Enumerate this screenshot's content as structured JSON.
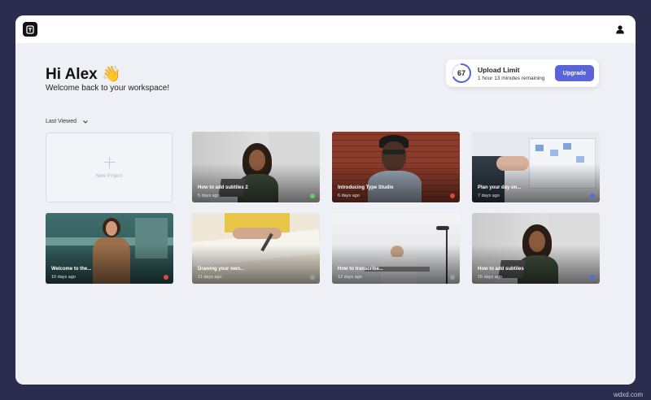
{
  "app": {
    "logo_icon": "document-logo-icon",
    "avatar_icon": "user-icon"
  },
  "header": {
    "greeting": "Hi Alex",
    "greeting_emoji": "👋",
    "subtitle": "Welcome back to your workspace!"
  },
  "upload_limit": {
    "value": "67",
    "title": "Upload Limit",
    "remaining": "1 hour 13 minutes remaining",
    "button": "Upgrade",
    "accent": "#5a63d8",
    "fraction": 0.67
  },
  "sort": {
    "label": "Last Viewed"
  },
  "new_project": {
    "label": "New Project"
  },
  "projects": [
    {
      "title": "How to add subtiles 2",
      "meta": "5 days ago",
      "status_color": "#5cd45c"
    },
    {
      "title": "Introducing Type Studio",
      "meta": "6 days ago",
      "status_color": "#e0483e"
    },
    {
      "title": "Plan your day on...",
      "meta": "7 days ago",
      "status_color": "#4c6fd8"
    },
    {
      "title": "Welcome to the...",
      "meta": "10 days ago",
      "status_color": "#e0483e"
    },
    {
      "title": "Drawing your own...",
      "meta": "11 days ago",
      "status_color": "#9a9ca4"
    },
    {
      "title": "How to transcribe...",
      "meta": "12 days ago",
      "status_color": "#9a9ca4"
    },
    {
      "title": "How to add subtiles",
      "meta": "15 days ago",
      "status_color": "#4c6fd8"
    }
  ],
  "watermark": "wdxd.com"
}
